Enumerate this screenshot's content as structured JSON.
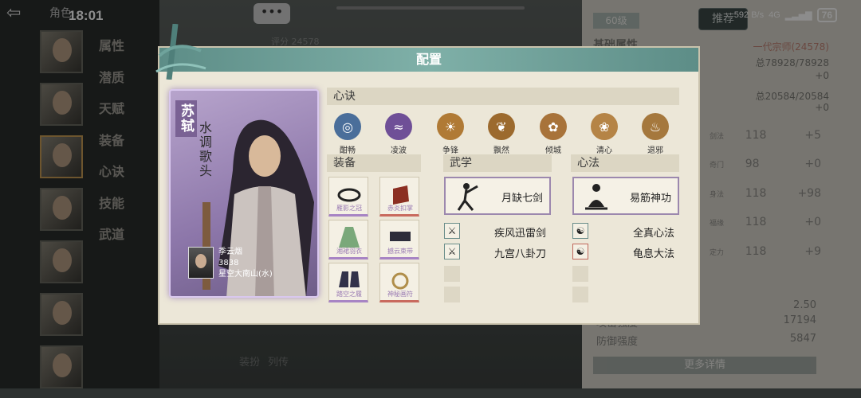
{
  "status": {
    "time": "18:01",
    "net_speed": "592 B/s",
    "network": "4G",
    "battery": "76"
  },
  "topbar": {
    "back": "⇦",
    "title": "角色",
    "chat": "•••",
    "recommend": "推荐",
    "level": "60级"
  },
  "nav": {
    "items": [
      "属性",
      "潜质",
      "天赋",
      "装备",
      "心诀",
      "技能",
      "武道"
    ]
  },
  "score": "评分 24578",
  "stats_bg": {
    "header": "基础属性",
    "title": "一代宗师(24578)",
    "hp": "总78928/78928",
    "hp_delta": "+0",
    "mp": "总20584/20584",
    "mp_delta": "+0",
    "rows": [
      {
        "label": "剑法",
        "value": "118",
        "bonus": "+5"
      },
      {
        "label": "奇门",
        "value": "98",
        "bonus": "+0"
      },
      {
        "label": "身法",
        "value": "118",
        "bonus": "+98"
      },
      {
        "label": "福缘",
        "value": "118",
        "bonus": "+0"
      },
      {
        "label": "定力",
        "value": "118",
        "bonus": "+9"
      }
    ],
    "crit": "2.50",
    "attack_label": "攻击强度",
    "attack": "17194",
    "defense_label": "防御强度",
    "defense": "5847",
    "more": "更多详情"
  },
  "bottom_tabs": [
    "装扮",
    "列传"
  ],
  "modal": {
    "title": "配置",
    "hero": {
      "name": "苏轼",
      "title": "水调歌头",
      "owner_name": "季云烟",
      "owner_power": "3838",
      "owner_server": "星空大南山(水)"
    },
    "xinjue": {
      "header": "心诀",
      "skills": [
        {
          "name": "酣畅",
          "color": "#4a6e9a",
          "icon": "swirl-icon"
        },
        {
          "name": "凌波",
          "color": "#6f4f97",
          "icon": "wave-icon"
        },
        {
          "name": "争锋",
          "color": "#b07a35",
          "icon": "sun-icon"
        },
        {
          "name": "飘然",
          "color": "#9c6a2e",
          "icon": "leaf-icon"
        },
        {
          "name": "倾城",
          "color": "#a8733a",
          "icon": "fan-icon"
        },
        {
          "name": "清心",
          "color": "#b58446",
          "icon": "lotus-icon"
        },
        {
          "name": "退邪",
          "color": "#a5783d",
          "icon": "flame-icon"
        }
      ]
    },
    "equip": {
      "header": "装备",
      "items": [
        {
          "name": "雁影之冠",
          "rarity": "purple"
        },
        {
          "name": "赤炎扣掌",
          "rarity": "red"
        },
        {
          "name": "湘裙羽衣",
          "rarity": "purple"
        },
        {
          "name": "撼云束带",
          "rarity": "purple"
        },
        {
          "name": "踏空之履",
          "rarity": "purple"
        },
        {
          "name": "神秘画符",
          "rarity": "red"
        }
      ]
    },
    "wuxue": {
      "header": "武学",
      "main": "月缺七剑",
      "subs": [
        "疾风迅雷剑",
        "九宫八卦刀"
      ]
    },
    "xinfa": {
      "header": "心法",
      "main": "易筋神功",
      "subs": [
        "全真心法",
        "龟息大法"
      ]
    }
  }
}
